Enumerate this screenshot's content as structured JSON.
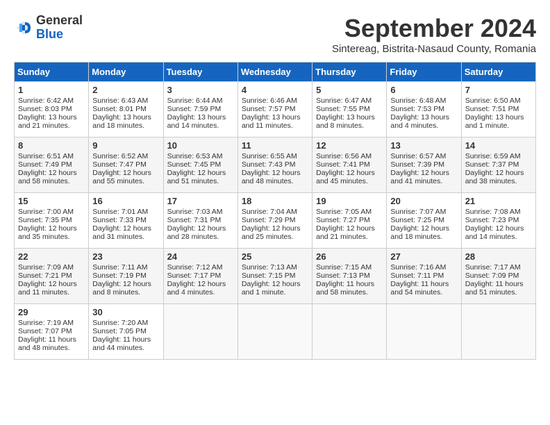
{
  "header": {
    "logo": {
      "general": "General",
      "blue": "Blue"
    },
    "title": "September 2024",
    "subtitle": "Sintereag, Bistrita-Nasaud County, Romania"
  },
  "calendar": {
    "days": [
      "Sunday",
      "Monday",
      "Tuesday",
      "Wednesday",
      "Thursday",
      "Friday",
      "Saturday"
    ],
    "weeks": [
      [
        null,
        {
          "day": 1,
          "lines": [
            "Sunrise: 6:42 AM",
            "Sunset: 8:03 PM",
            "Daylight: 13 hours",
            "and 21 minutes."
          ]
        },
        {
          "day": 2,
          "lines": [
            "Sunrise: 6:43 AM",
            "Sunset: 8:01 PM",
            "Daylight: 13 hours",
            "and 18 minutes."
          ]
        },
        {
          "day": 3,
          "lines": [
            "Sunrise: 6:44 AM",
            "Sunset: 7:59 PM",
            "Daylight: 13 hours",
            "and 14 minutes."
          ]
        },
        {
          "day": 4,
          "lines": [
            "Sunrise: 6:46 AM",
            "Sunset: 7:57 PM",
            "Daylight: 13 hours",
            "and 11 minutes."
          ]
        },
        {
          "day": 5,
          "lines": [
            "Sunrise: 6:47 AM",
            "Sunset: 7:55 PM",
            "Daylight: 13 hours",
            "and 8 minutes."
          ]
        },
        {
          "day": 6,
          "lines": [
            "Sunrise: 6:48 AM",
            "Sunset: 7:53 PM",
            "Daylight: 13 hours",
            "and 4 minutes."
          ]
        },
        {
          "day": 7,
          "lines": [
            "Sunrise: 6:50 AM",
            "Sunset: 7:51 PM",
            "Daylight: 13 hours",
            "and 1 minute."
          ]
        }
      ],
      [
        {
          "day": 8,
          "lines": [
            "Sunrise: 6:51 AM",
            "Sunset: 7:49 PM",
            "Daylight: 12 hours",
            "and 58 minutes."
          ]
        },
        {
          "day": 9,
          "lines": [
            "Sunrise: 6:52 AM",
            "Sunset: 7:47 PM",
            "Daylight: 12 hours",
            "and 55 minutes."
          ]
        },
        {
          "day": 10,
          "lines": [
            "Sunrise: 6:53 AM",
            "Sunset: 7:45 PM",
            "Daylight: 12 hours",
            "and 51 minutes."
          ]
        },
        {
          "day": 11,
          "lines": [
            "Sunrise: 6:55 AM",
            "Sunset: 7:43 PM",
            "Daylight: 12 hours",
            "and 48 minutes."
          ]
        },
        {
          "day": 12,
          "lines": [
            "Sunrise: 6:56 AM",
            "Sunset: 7:41 PM",
            "Daylight: 12 hours",
            "and 45 minutes."
          ]
        },
        {
          "day": 13,
          "lines": [
            "Sunrise: 6:57 AM",
            "Sunset: 7:39 PM",
            "Daylight: 12 hours",
            "and 41 minutes."
          ]
        },
        {
          "day": 14,
          "lines": [
            "Sunrise: 6:59 AM",
            "Sunset: 7:37 PM",
            "Daylight: 12 hours",
            "and 38 minutes."
          ]
        }
      ],
      [
        {
          "day": 15,
          "lines": [
            "Sunrise: 7:00 AM",
            "Sunset: 7:35 PM",
            "Daylight: 12 hours",
            "and 35 minutes."
          ]
        },
        {
          "day": 16,
          "lines": [
            "Sunrise: 7:01 AM",
            "Sunset: 7:33 PM",
            "Daylight: 12 hours",
            "and 31 minutes."
          ]
        },
        {
          "day": 17,
          "lines": [
            "Sunrise: 7:03 AM",
            "Sunset: 7:31 PM",
            "Daylight: 12 hours",
            "and 28 minutes."
          ]
        },
        {
          "day": 18,
          "lines": [
            "Sunrise: 7:04 AM",
            "Sunset: 7:29 PM",
            "Daylight: 12 hours",
            "and 25 minutes."
          ]
        },
        {
          "day": 19,
          "lines": [
            "Sunrise: 7:05 AM",
            "Sunset: 7:27 PM",
            "Daylight: 12 hours",
            "and 21 minutes."
          ]
        },
        {
          "day": 20,
          "lines": [
            "Sunrise: 7:07 AM",
            "Sunset: 7:25 PM",
            "Daylight: 12 hours",
            "and 18 minutes."
          ]
        },
        {
          "day": 21,
          "lines": [
            "Sunrise: 7:08 AM",
            "Sunset: 7:23 PM",
            "Daylight: 12 hours",
            "and 14 minutes."
          ]
        }
      ],
      [
        {
          "day": 22,
          "lines": [
            "Sunrise: 7:09 AM",
            "Sunset: 7:21 PM",
            "Daylight: 12 hours",
            "and 11 minutes."
          ]
        },
        {
          "day": 23,
          "lines": [
            "Sunrise: 7:11 AM",
            "Sunset: 7:19 PM",
            "Daylight: 12 hours",
            "and 8 minutes."
          ]
        },
        {
          "day": 24,
          "lines": [
            "Sunrise: 7:12 AM",
            "Sunset: 7:17 PM",
            "Daylight: 12 hours",
            "and 4 minutes."
          ]
        },
        {
          "day": 25,
          "lines": [
            "Sunrise: 7:13 AM",
            "Sunset: 7:15 PM",
            "Daylight: 12 hours",
            "and 1 minute."
          ]
        },
        {
          "day": 26,
          "lines": [
            "Sunrise: 7:15 AM",
            "Sunset: 7:13 PM",
            "Daylight: 11 hours",
            "and 58 minutes."
          ]
        },
        {
          "day": 27,
          "lines": [
            "Sunrise: 7:16 AM",
            "Sunset: 7:11 PM",
            "Daylight: 11 hours",
            "and 54 minutes."
          ]
        },
        {
          "day": 28,
          "lines": [
            "Sunrise: 7:17 AM",
            "Sunset: 7:09 PM",
            "Daylight: 11 hours",
            "and 51 minutes."
          ]
        }
      ],
      [
        {
          "day": 29,
          "lines": [
            "Sunrise: 7:19 AM",
            "Sunset: 7:07 PM",
            "Daylight: 11 hours",
            "and 48 minutes."
          ]
        },
        {
          "day": 30,
          "lines": [
            "Sunrise: 7:20 AM",
            "Sunset: 7:05 PM",
            "Daylight: 11 hours",
            "and 44 minutes."
          ]
        },
        null,
        null,
        null,
        null,
        null
      ]
    ]
  }
}
